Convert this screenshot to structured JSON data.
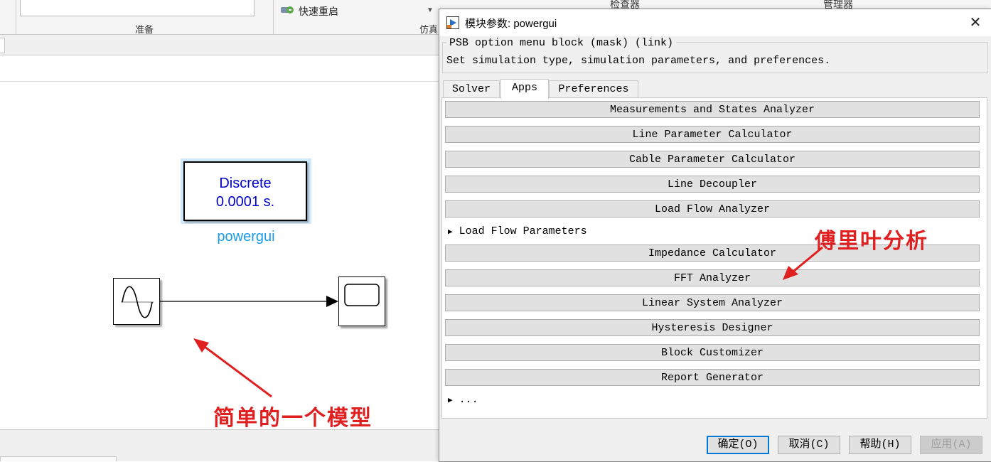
{
  "toolstrip": {
    "section_prepare": "准备",
    "section_simulation": "仿真",
    "quick_restart": "快速重启",
    "right_label1": "检查器",
    "right_label2": "管理器"
  },
  "model": {
    "powergui_line1": "Discrete",
    "powergui_line2": "0.0001 s.",
    "powergui_name": "powergui",
    "annotation_model": "简单的一个模型",
    "annotation_fft": "傅里叶分析"
  },
  "dialog": {
    "title": "模块参数: powergui",
    "close": "✕",
    "mask_label": "PSB option menu block (mask) (link)",
    "mask_description": "Set simulation type, simulation parameters, and preferences.",
    "tabs": [
      {
        "label": "Solver"
      },
      {
        "label": "Apps"
      },
      {
        "label": "Preferences"
      }
    ],
    "apps": {
      "measurements": "Measurements and States Analyzer",
      "line_param": "Line Parameter Calculator",
      "cable_param": "Cable Parameter Calculator",
      "line_decoupler": "Line Decoupler",
      "load_flow": "Load Flow Analyzer",
      "load_flow_params": "Load Flow Parameters",
      "impedance": "Impedance Calculator",
      "fft": "FFT Analyzer",
      "linear": "Linear System Analyzer",
      "hysteresis": "Hysteresis Designer",
      "block_customizer": "Block Customizer",
      "report": "Report Generator",
      "more": "..."
    },
    "buttons": {
      "ok": "确定(O)",
      "cancel": "取消(C)",
      "help": "帮助(H)",
      "apply": "应用(A)"
    }
  },
  "colors": {
    "annotation": "#e02020",
    "powergui_text": "#0000c8",
    "powergui_caption": "#1a9be6",
    "selection": "#cfe8fa",
    "default_button_border": "#0078d7"
  },
  "icons": {
    "restart": "restart-icon",
    "dialog": "simulink-block-icon",
    "expand": "triangle-right-icon"
  }
}
